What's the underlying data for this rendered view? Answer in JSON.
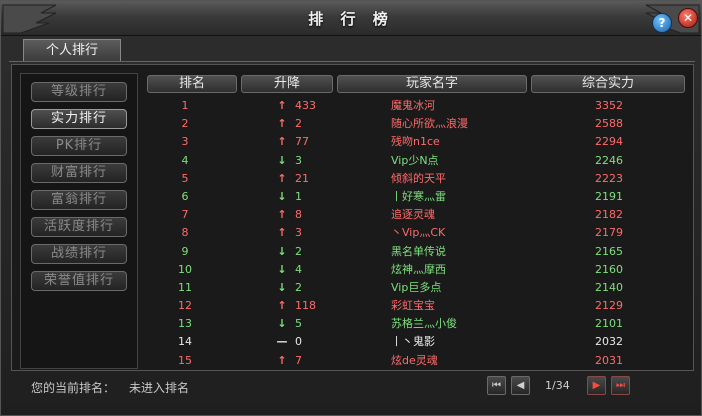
{
  "window": {
    "title": "排 行 榜",
    "help_label": "?",
    "close_label": "✕"
  },
  "tab": {
    "label": "个人排行"
  },
  "sidebar": {
    "items": [
      {
        "label": "等级排行",
        "active": false
      },
      {
        "label": "实力排行",
        "active": true
      },
      {
        "label": "PK排行",
        "active": false
      },
      {
        "label": "财富排行",
        "active": false
      },
      {
        "label": "富翁排行",
        "active": false
      },
      {
        "label": "活跃度排行",
        "active": false
      },
      {
        "label": "战绩排行",
        "active": false
      },
      {
        "label": "荣誉值排行",
        "active": false
      }
    ]
  },
  "table": {
    "headers": {
      "rank": "排名",
      "change": "升降",
      "name": "玩家名字",
      "power": "综合实力"
    },
    "rows": [
      {
        "rank": "1",
        "dir": "up",
        "delta": "433",
        "name": "魔鬼冰河",
        "power": "3352",
        "color": "#ff6b6b"
      },
      {
        "rank": "2",
        "dir": "up",
        "delta": "2",
        "name": "随心所欲灬浪漫",
        "power": "2588",
        "color": "#ff6b6b"
      },
      {
        "rank": "3",
        "dir": "up",
        "delta": "77",
        "name": "残吻n1ce",
        "power": "2294",
        "color": "#ff6b6b"
      },
      {
        "rank": "4",
        "dir": "down",
        "delta": "3",
        "name": "Vip少N点",
        "power": "2246",
        "color": "#7ee07e"
      },
      {
        "rank": "5",
        "dir": "up",
        "delta": "21",
        "name": "倾斜的天平",
        "power": "2223",
        "color": "#ff6b6b"
      },
      {
        "rank": "6",
        "dir": "down",
        "delta": "1",
        "name": "丨好寒灬雷",
        "power": "2191",
        "color": "#7ee07e"
      },
      {
        "rank": "7",
        "dir": "up",
        "delta": "8",
        "name": "追逐灵魂",
        "power": "2182",
        "color": "#ff6b6b"
      },
      {
        "rank": "8",
        "dir": "up",
        "delta": "3",
        "name": "丶Vip灬CK",
        "power": "2179",
        "color": "#ff6b6b"
      },
      {
        "rank": "9",
        "dir": "down",
        "delta": "2",
        "name": "黑名单传说",
        "power": "2165",
        "color": "#7ee07e"
      },
      {
        "rank": "10",
        "dir": "down",
        "delta": "4",
        "name": "炫神灬摩西",
        "power": "2160",
        "color": "#7ee07e"
      },
      {
        "rank": "11",
        "dir": "down",
        "delta": "2",
        "name": "Vip巨多点",
        "power": "2140",
        "color": "#7ee07e"
      },
      {
        "rank": "12",
        "dir": "up",
        "delta": "118",
        "name": "彩虹宝宝",
        "power": "2129",
        "color": "#ff6b6b"
      },
      {
        "rank": "13",
        "dir": "down",
        "delta": "5",
        "name": "苏格兰灬小俊",
        "power": "2101",
        "color": "#7ee07e"
      },
      {
        "rank": "14",
        "dir": "same",
        "delta": "0",
        "name": "丨丶鬼影",
        "power": "2032",
        "color": "#e8e8e8"
      },
      {
        "rank": "15",
        "dir": "up",
        "delta": "7",
        "name": "炫de灵魂",
        "power": "2031",
        "color": "#ff6b6b"
      }
    ]
  },
  "footer": {
    "current_rank_label": "您的当前排名：",
    "current_rank_value": "未进入排名",
    "page_info": "1/34",
    "first_icon": "⏮",
    "prev_icon": "◀",
    "next_icon": "▶",
    "last_icon": "⏭"
  },
  "colors": {
    "up": "#ff6b6b",
    "down": "#7ee07e",
    "same": "#e8e8e8"
  },
  "icons": {
    "up": "↑",
    "down": "↓",
    "same": "—"
  }
}
